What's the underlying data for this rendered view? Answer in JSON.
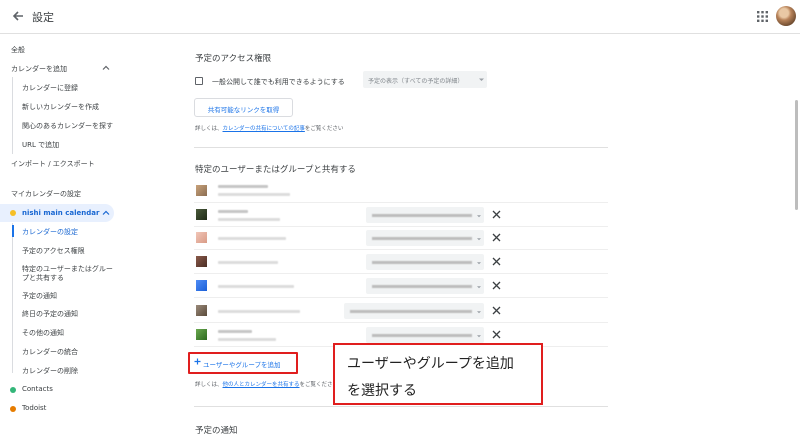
{
  "header": {
    "title": "設定",
    "back_icon": "arrow-left-icon",
    "apps_icon": "apps-grid-icon"
  },
  "sidebar": {
    "general": "全般",
    "add_calendar": "カレンダーを追加",
    "add_calendar_items": [
      "カレンダーに登録",
      "新しいカレンダーを作成",
      "関心のあるカレンダーを探す",
      "URL で追加"
    ],
    "import_export": "インポート / エクスポート",
    "my_calendar_settings": "マイカレンダーの設定",
    "active_calendar": "nishi main calendar",
    "active_calendar_items": [
      "カレンダーの設定",
      "予定のアクセス権限",
      "特定のユーザーまたはグルー",
      "プと共有する",
      "予定の通知",
      "終日の予定の通知",
      "その他の通知",
      "カレンダーの統合",
      "カレンダーの削除"
    ],
    "other_calendars": [
      {
        "label": "Contacts",
        "color": "#33b679"
      },
      {
        "label": "Todoist",
        "color": "#e67c00"
      }
    ],
    "active_calendar_color": "#f6bf26"
  },
  "access": {
    "title": "予定のアクセス権限",
    "public_label": "一般公開して誰でも利用できるようにする",
    "select_value": "予定の表示（すべての予定の詳細）",
    "share_link_button": "共有可能なリンクを取得",
    "help_prefix": "詳しくは、",
    "help_link": "カレンダーの共有についての記事",
    "help_suffix": "をご覧ください"
  },
  "share": {
    "title": "特定のユーザーまたはグループと共有する",
    "add_button": "ユーザーやグループを追加",
    "help_prefix": "詳しくは、",
    "help_link": "他の人とカレンダーを共有する",
    "help_suffix": "をご覧ください"
  },
  "callout": {
    "line1": "ユーザーやグループを追加",
    "line2": "を選択する"
  },
  "notifications": {
    "title": "予定の通知"
  },
  "colors": {
    "accent": "#1a73e8",
    "highlight": "#e01e1e"
  }
}
